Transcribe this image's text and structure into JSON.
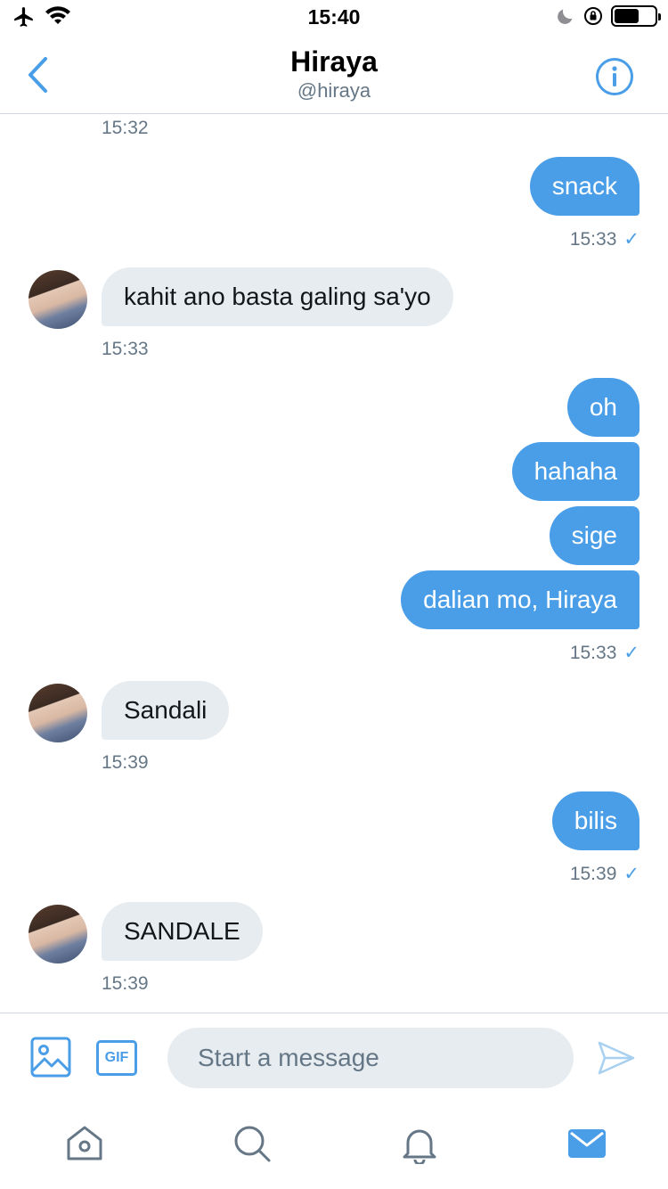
{
  "status_bar": {
    "time": "15:40",
    "battery_level": 0.62,
    "icons": [
      "airplane-icon",
      "wifi-icon",
      "moon-icon",
      "orientation-lock-icon",
      "battery-icon"
    ]
  },
  "header": {
    "name": "Hiraya",
    "handle": "@hiraya",
    "back_icon": "chevron-left-icon",
    "info_icon": "info-icon"
  },
  "colors": {
    "accent": "#4a9ee8",
    "incoming_bubble": "#e6ecf0",
    "muted_text": "#657786"
  },
  "messages": {
    "m0_time": "15:32",
    "m1": {
      "text": "snack",
      "time": "15:33",
      "status": "✓"
    },
    "m2": {
      "text": "kahit ano basta galing sa'yo",
      "time": "15:33"
    },
    "m3": {
      "text": "oh"
    },
    "m4": {
      "text": "hahaha"
    },
    "m5": {
      "text": "sige"
    },
    "m6": {
      "text": "dalian mo, Hiraya",
      "time": "15:33",
      "status": "✓"
    },
    "m7": {
      "text": "Sandali",
      "time": "15:39"
    },
    "m8": {
      "text": "bilis",
      "time": "15:39",
      "status": "✓"
    },
    "m9": {
      "text": "SANDALE",
      "time": "15:39"
    }
  },
  "composer": {
    "placeholder": "Start a message",
    "gif_label": "GIF",
    "media_icon": "image-icon",
    "send_icon": "send-icon"
  },
  "tabbar": {
    "tabs": [
      "home-icon",
      "search-icon",
      "notifications-icon",
      "messages-icon"
    ],
    "active": "messages-icon"
  }
}
